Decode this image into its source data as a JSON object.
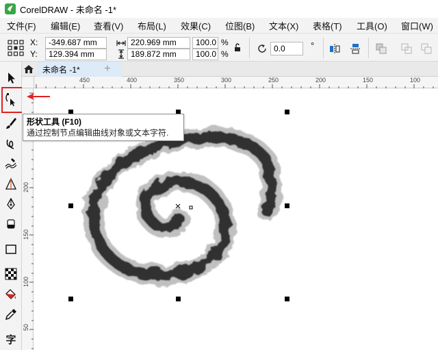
{
  "window": {
    "title": "CorelDRAW - 未命名 -1*"
  },
  "menubar": {
    "items": [
      {
        "label": "文件(F)"
      },
      {
        "label": "编辑(E)"
      },
      {
        "label": "查看(V)"
      },
      {
        "label": "布局(L)"
      },
      {
        "label": "效果(C)"
      },
      {
        "label": "位图(B)"
      },
      {
        "label": "文本(X)"
      },
      {
        "label": "表格(T)"
      },
      {
        "label": "工具(O)"
      },
      {
        "label": "窗口(W)"
      }
    ]
  },
  "propbar": {
    "x_label": "X:",
    "x_value": "-349.687 mm",
    "y_label": "Y:",
    "y_value": "129.394 mm",
    "width_value": "220.969 mm",
    "height_value": "189.872 mm",
    "scale_w": "100.0",
    "scale_h": "100.0",
    "percent_1": "%",
    "percent_2": "%",
    "rotation_value": "0.0",
    "degree_symbol": "°"
  },
  "tabbar": {
    "doc_tab": "未命名 -1*",
    "add_tab": "+"
  },
  "rulers": {
    "h_ticks": [
      "450",
      "400",
      "350",
      "300",
      "250",
      "200",
      "150",
      "100"
    ],
    "v_ticks": [
      "200",
      "150",
      "100",
      "50"
    ]
  },
  "tooltip": {
    "title": "形状工具 (F10)",
    "description": "通过控制节点编辑曲线对象或文本字符."
  },
  "toolbox": {
    "text_tool_glyph": "字"
  },
  "colors": {
    "highlight": "#e02020",
    "ui_bg": "#f3f3f3",
    "ink": "#1a1a1a"
  }
}
